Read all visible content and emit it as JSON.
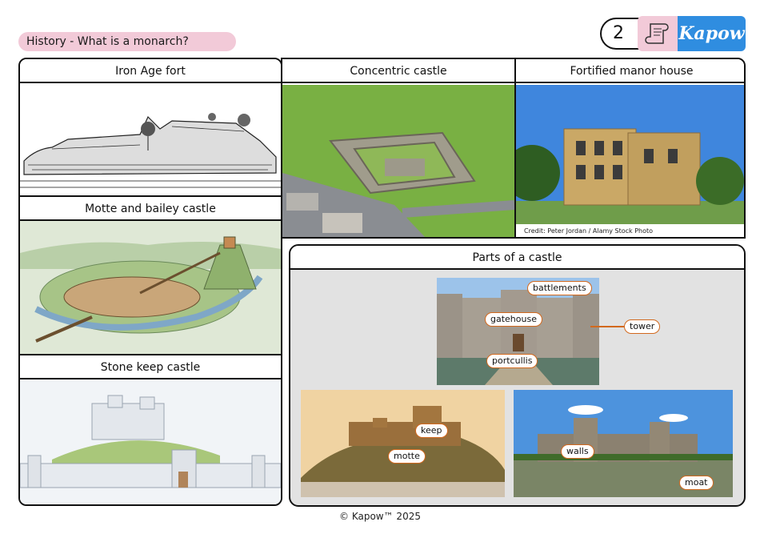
{
  "header": {
    "title": "History - What is a monarch?",
    "page_number": "2",
    "logo_text": "Kapow"
  },
  "left_panel": {
    "sections": [
      {
        "caption": "Iron Age fort"
      },
      {
        "caption": "Motte and bailey castle"
      },
      {
        "caption": "Stone keep castle"
      }
    ]
  },
  "top_right": {
    "concentric": {
      "caption": "Concentric castle"
    },
    "manor": {
      "caption": "Fortified manor house",
      "credit": "Credit: Peter Jordan / Alamy Stock Photo"
    }
  },
  "parts": {
    "caption": "Parts of a castle",
    "labels": {
      "battlements": "battlements",
      "gatehouse": "gatehouse",
      "tower": "tower",
      "portcullis": "portcullis",
      "keep": "keep",
      "motte": "motte",
      "walls": "walls",
      "moat": "moat"
    }
  },
  "footer": {
    "text": "© Kapow™ 2025"
  },
  "colors": {
    "accent_pink": "#f2cad8",
    "brand_blue": "#2f8de0",
    "label_outline": "#d2691e"
  }
}
